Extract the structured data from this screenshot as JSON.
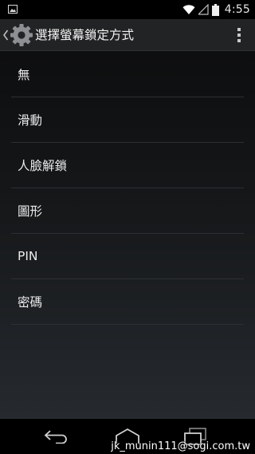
{
  "status_bar": {
    "notification_icon": "image-icon",
    "wifi_icon": "wifi-icon",
    "signal_icon": "cell-signal-icon",
    "battery_icon": "battery-icon",
    "time": "4:55"
  },
  "action_bar": {
    "up_icon": "chevron-left-icon",
    "app_icon": "gear-icon",
    "title": "選擇螢幕鎖定方式",
    "menu_icon": "overflow-menu-icon"
  },
  "options": [
    {
      "label": "無"
    },
    {
      "label": "滑動"
    },
    {
      "label": "人臉解鎖"
    },
    {
      "label": "圖形"
    },
    {
      "label": "PIN"
    },
    {
      "label": "密碼"
    }
  ],
  "nav_bar": {
    "back_icon": "back-icon",
    "home_icon": "home-icon",
    "recents_icon": "recents-icon"
  },
  "watermark": "jk_munin111@sogi.com.tw",
  "colors": {
    "action_bar_bg": "#222324",
    "divider": "#2c2f33",
    "text": "#ececec"
  }
}
